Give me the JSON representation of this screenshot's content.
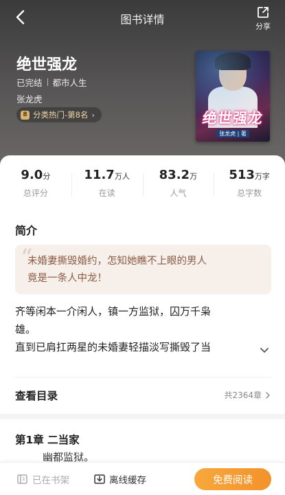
{
  "header": {
    "title": "图书详情",
    "share_label": "分享"
  },
  "book": {
    "title": "绝世强龙",
    "status": "已完结",
    "category": "都市人生",
    "author": "张龙虎",
    "rank_badge": "8",
    "rank_text": "分类热门-第8名",
    "cover_title": "绝世强龙",
    "cover_author": "张龙虎 | 著"
  },
  "stats": [
    {
      "value": "9.0",
      "unit": "分",
      "label": "总评分"
    },
    {
      "value": "11.7",
      "unit": "万人",
      "label": "在读"
    },
    {
      "value": "83.2",
      "unit": "万",
      "label": "人气"
    },
    {
      "value": "513",
      "unit": "万字",
      "label": "总字数"
    }
  ],
  "synopsis": {
    "section_title": "简介",
    "quote_mark": "“",
    "quote_line1": "未婚妻撕毁婚约，怎知她瞧不上眼的男人",
    "quote_line2": "竟是一条人中龙！",
    "intro_line1": "齐等闲本一介闲人，镇一方监狱，囚万千枭",
    "intro_line2": "雄。",
    "intro_line3": "直到已肩扛两星的未婚妻轻描淡写撕毁了当"
  },
  "toc": {
    "label": "查看目录",
    "count": "共2364章"
  },
  "chapter": {
    "title": "第1章 二当家",
    "first_line": "幽都监狱。"
  },
  "bottom_bar": {
    "shelf_label": "已在书架",
    "cache_label": "离线缓存",
    "read_label": "免费阅读"
  },
  "colors": {
    "accent": "#f3922b",
    "quote_bg": "#f7efea",
    "quote_text": "#8a5c45"
  }
}
